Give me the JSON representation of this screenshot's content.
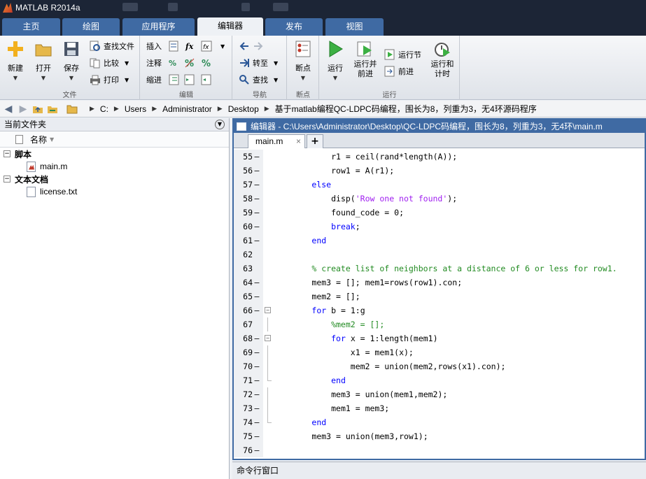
{
  "window": {
    "title": "MATLAB R2014a"
  },
  "tabs": [
    {
      "label": "主页",
      "active": false
    },
    {
      "label": "绘图",
      "active": false
    },
    {
      "label": "应用程序",
      "active": false
    },
    {
      "label": "编辑器",
      "active": true
    },
    {
      "label": "发布",
      "active": false
    },
    {
      "label": "视图",
      "active": false
    }
  ],
  "ribbon": {
    "file": {
      "group_label": "文件",
      "new_label": "新建",
      "open_label": "打开",
      "save_label": "保存",
      "find_files_label": "查找文件",
      "compare_label": "比较",
      "print_label": "打印"
    },
    "edit": {
      "group_label": "编辑",
      "insert_label": "插入",
      "fx_label": "fx",
      "comment_label": "注释",
      "percent_label": "%",
      "indent_label": "缩进"
    },
    "navigate": {
      "group_label": "导航",
      "goto_label": "转至",
      "find_label": "查找"
    },
    "breakpoints": {
      "group_label": "断点",
      "breakpoints_label": "断点"
    },
    "run": {
      "group_label": "运行",
      "run_label": "运行",
      "run_advance_label": "运行并\n前进",
      "run_section_label": "运行节",
      "advance_label": "前进",
      "run_time_label": "运行和\n计时"
    }
  },
  "address": {
    "segments": [
      "C:",
      "Users",
      "Administrator",
      "Desktop",
      "基于matlab编程QC-LDPC码编程，围长为8，列重为3，无4环源码程序"
    ]
  },
  "current_folder": {
    "title": "当前文件夹",
    "column_name": "名称",
    "groups": [
      {
        "label": "脚本",
        "items": [
          {
            "name": "main.m",
            "type": "m"
          }
        ]
      },
      {
        "label": "文本文档",
        "items": [
          {
            "name": "license.txt",
            "type": "txt"
          }
        ]
      }
    ]
  },
  "editor": {
    "title": "编辑器 - C:\\Users\\Administrator\\Desktop\\QC-LDPC码编程，围长为8，列重为3，无4环\\main.m",
    "tab_label": "main.m",
    "tab_close": "×",
    "add_tab": "+",
    "lines": [
      {
        "n": "55",
        "dash": "–",
        "text": "            r1 = ceil(rand*length(A));"
      },
      {
        "n": "56",
        "dash": "–",
        "text": "            row1 = A(r1);"
      },
      {
        "n": "57",
        "dash": "–",
        "text": "        else"
      },
      {
        "n": "58",
        "dash": "–",
        "text": "            disp('Row one not found');"
      },
      {
        "n": "59",
        "dash": "–",
        "text": "            found_code = 0;"
      },
      {
        "n": "60",
        "dash": "–",
        "text": "            break;"
      },
      {
        "n": "61",
        "dash": "–",
        "text": "        end"
      },
      {
        "n": "62",
        "dash": "",
        "text": ""
      },
      {
        "n": "63",
        "dash": "",
        "text": "        % create list of neighbors at a distance of 6 or less for row1."
      },
      {
        "n": "64",
        "dash": "–",
        "text": "        mem3 = []; mem1=rows(row1).con;"
      },
      {
        "n": "65",
        "dash": "–",
        "text": "        mem2 = [];"
      },
      {
        "n": "66",
        "dash": "–",
        "text": "        for b = 1:g"
      },
      {
        "n": "67",
        "dash": "",
        "text": "            %mem2 = [];"
      },
      {
        "n": "68",
        "dash": "–",
        "text": "            for x = 1:length(mem1)"
      },
      {
        "n": "69",
        "dash": "–",
        "text": "                x1 = mem1(x);"
      },
      {
        "n": "70",
        "dash": "–",
        "text": "                mem2 = union(mem2,rows(x1).con);"
      },
      {
        "n": "71",
        "dash": "–",
        "text": "            end"
      },
      {
        "n": "72",
        "dash": "–",
        "text": "            mem3 = union(mem1,mem2);"
      },
      {
        "n": "73",
        "dash": "–",
        "text": "            mem1 = mem3;"
      },
      {
        "n": "74",
        "dash": "–",
        "text": "        end"
      },
      {
        "n": "75",
        "dash": "–",
        "text": "        mem3 = union(mem3,row1);"
      },
      {
        "n": "76",
        "dash": "–",
        "text": ""
      }
    ]
  },
  "command_window": {
    "title": "命令行窗口"
  },
  "colors": {
    "accent": "#3f6aa3",
    "titlebar": "#1c2536",
    "keyword": "#0000ff",
    "string": "#a020f0",
    "comment": "#228b22"
  }
}
